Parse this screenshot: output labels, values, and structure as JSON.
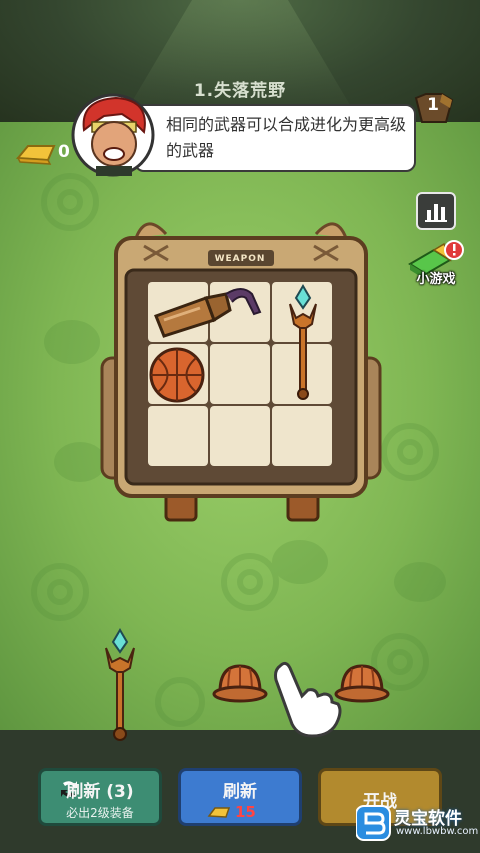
{
  "header": {
    "level_title": "1.失落荒野",
    "gold": "0",
    "player_level": "1"
  },
  "tutorial": {
    "message": "相同的武器可以合成进化为更高级的武器"
  },
  "side": {
    "rank_icon": "bar-chart-icon",
    "mini_game_label": "小游戏"
  },
  "backpack": {
    "label": "WEAPON",
    "grid": [
      [
        "bottle-weapon",
        "bottle-weapon",
        "crystal-staff"
      ],
      [
        "basketball",
        "empty",
        "crystal-staff"
      ],
      [
        "empty",
        "empty",
        "empty"
      ]
    ]
  },
  "shop_items": [
    "crystal-staff",
    "helmet",
    "helmet"
  ],
  "buttons": {
    "refresh_a_title": "刷新 (3)",
    "refresh_a_sub": "必出2级装备",
    "refresh_b_title": "刷新",
    "refresh_b_cost": "15",
    "start_title": "开战"
  },
  "watermark": {
    "name": "灵宝软件",
    "url": "www.lbwbw.com"
  },
  "colors": {
    "accent_gold": "#f2c33a",
    "cost_red": "#ff4444",
    "refresh_green": "#3d8d73",
    "refresh_blue": "#3d7bd0",
    "start_gold": "#b28a2e"
  }
}
